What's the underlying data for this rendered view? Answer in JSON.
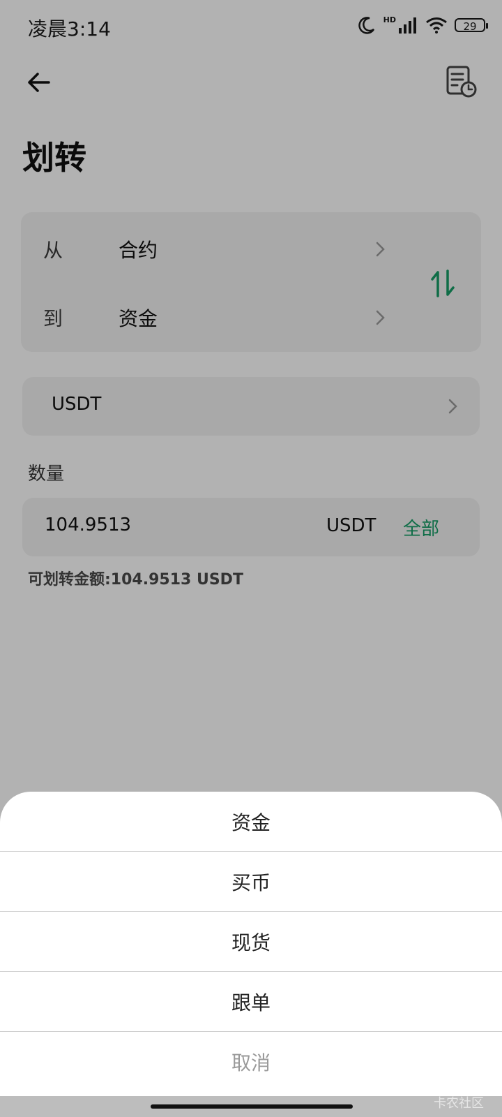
{
  "status_bar": {
    "time": "凌晨3:14",
    "battery": "29",
    "network_label": "HD"
  },
  "header": {
    "title": "划转"
  },
  "transfer": {
    "from_label": "从",
    "from_value": "合约",
    "to_label": "到",
    "to_value": "资金",
    "swap_color": "#169d66"
  },
  "coin": {
    "selected": "USDT"
  },
  "quantity": {
    "label": "数量",
    "value": "104.9513",
    "unit": "USDT",
    "all_label": "全部"
  },
  "available": {
    "text": "可划转金额:104.9513 USDT"
  },
  "sheet": {
    "options": [
      "资金",
      "买币",
      "现货",
      "跟单"
    ],
    "cancel": "取消"
  },
  "watermark": "卡农社区",
  "colors": {
    "accent": "#169d66",
    "overlay": "rgba(0,0,0,0.30)"
  }
}
